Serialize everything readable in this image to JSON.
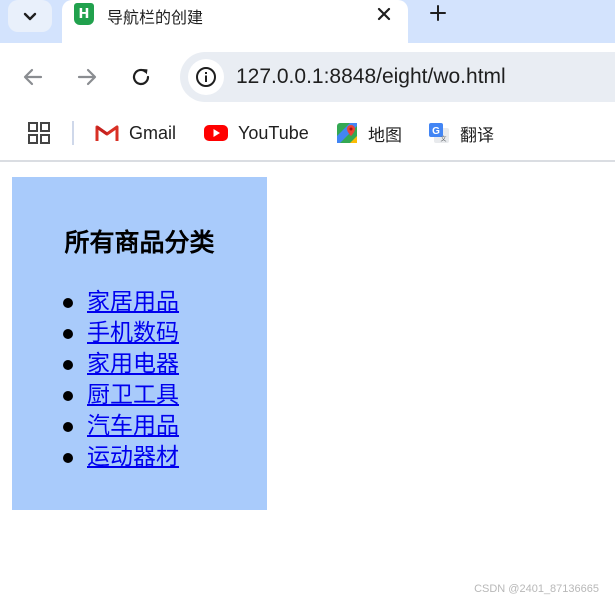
{
  "browser": {
    "tab": {
      "title": "导航栏的创建",
      "favicon_letter": "H"
    },
    "address_bar": {
      "url": "127.0.0.1:8848/eight/wo.html"
    },
    "bookmarks": [
      {
        "label": "Gmail",
        "icon": "gmail-icon"
      },
      {
        "label": "YouTube",
        "icon": "youtube-icon"
      },
      {
        "label": "地图",
        "icon": "maps-icon"
      },
      {
        "label": "翻译",
        "icon": "translate-icon"
      }
    ],
    "colors": {
      "tab_strip": "#d3e3fd",
      "omnibox": "#e9edf3",
      "favicon": "#21a14d"
    }
  },
  "page": {
    "nav": {
      "heading": "所有商品分类",
      "items": [
        "家居用品",
        "手机数码",
        "家用电器",
        "厨卫工具",
        "汽车用品",
        "运动器材"
      ],
      "background": "#a9cbfb",
      "link_color": "#0000ee"
    }
  },
  "watermark": "CSDN @2401_87136665"
}
